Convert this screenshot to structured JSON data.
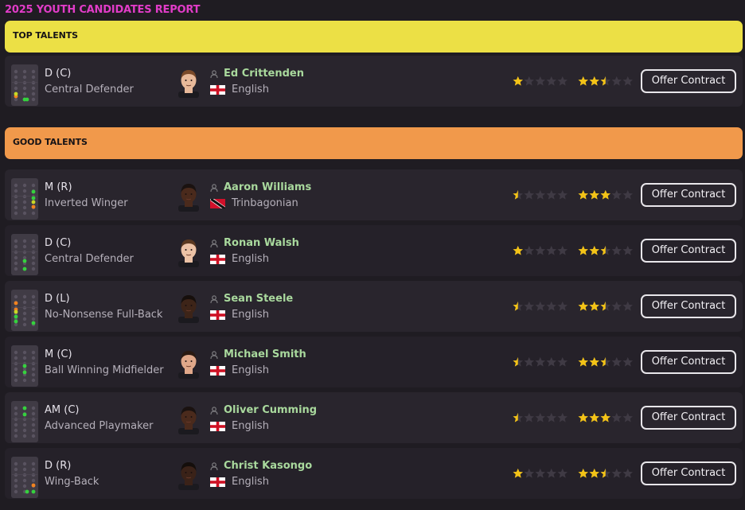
{
  "title": "2025 YOUTH CANDIDATES REPORT",
  "colors": {
    "title": "#e13cc8",
    "top_talents": "#ece045",
    "good_talents": "#f1994b",
    "name": "#a9d99d",
    "star_full": "#f3c317",
    "star_empty": "#3f3a44",
    "dot_green": "#35d23e",
    "dot_orange": "#f28320",
    "dot_yellow": "#c8d826"
  },
  "sections": [
    {
      "label": "TOP TALENTS",
      "color": "#ece045",
      "players": [
        {
          "position": "D (C)",
          "role": "Central Defender",
          "name": "Ed Crittenden",
          "nationality": "English",
          "flag": "england",
          "current_ability_stars": 1.0,
          "potential_ability_stars": 2.5,
          "skin": "#e8b99a",
          "hair": "#7a4a2a",
          "dots": [
            [
              "dl",
              "orange"
            ],
            [
              "dl2",
              "yellow"
            ],
            [
              "dc",
              "green"
            ],
            [
              "dcr",
              "green"
            ]
          ],
          "action": "Offer Contract"
        }
      ]
    },
    {
      "label": "GOOD TALENTS",
      "color": "#f1994b",
      "players": [
        {
          "position": "M (R)",
          "role": "Inverted Winger",
          "name": "Aaron Williams",
          "nationality": "Trinbagonian",
          "flag": "trinidad",
          "current_ability_stars": 0.5,
          "potential_ability_stars": 3.0,
          "skin": "#4a2a1c",
          "hair": "#1a1210",
          "dots": [
            [
              "amr",
              "green"
            ],
            [
              "mr",
              "green"
            ],
            [
              "mr2",
              "yellow"
            ],
            [
              "wbr",
              "orange"
            ]
          ],
          "action": "Offer Contract"
        },
        {
          "position": "D (C)",
          "role": "Central Defender",
          "name": "Ronan Walsh",
          "nationality": "English",
          "flag": "england",
          "current_ability_stars": 1.0,
          "potential_ability_stars": 2.5,
          "skin": "#ecc2a6",
          "hair": "#5a3820",
          "dots": [
            [
              "dm",
              "green"
            ],
            [
              "dc",
              "green"
            ]
          ],
          "action": "Offer Contract"
        },
        {
          "position": "D (L)",
          "role": "No-Nonsense Full-Back",
          "name": "Sean Steele",
          "nationality": "English",
          "flag": "england",
          "current_ability_stars": 0.5,
          "potential_ability_stars": 2.5,
          "skin": "#3d2418",
          "hair": "#160f0c",
          "dots": [
            [
              "aml",
              "orange"
            ],
            [
              "ml",
              "orange"
            ],
            [
              "ml2",
              "yellow"
            ],
            [
              "wbl",
              "green"
            ],
            [
              "dl",
              "green"
            ],
            [
              "dc2",
              "green"
            ]
          ],
          "action": "Offer Contract"
        },
        {
          "position": "M (C)",
          "role": "Ball Winning Midfielder",
          "name": "Michael Smith",
          "nationality": "English",
          "flag": "england",
          "current_ability_stars": 0.5,
          "potential_ability_stars": 2.5,
          "skin": "#e0a88a",
          "hair": "#2a1a12",
          "dots": [
            [
              "mc",
              "green"
            ],
            [
              "dm",
              "green"
            ]
          ],
          "action": "Offer Contract"
        },
        {
          "position": "AM (C)",
          "role": "Advanced Playmaker",
          "name": "Oliver Cumming",
          "nationality": "English",
          "flag": "england",
          "current_ability_stars": 0.5,
          "potential_ability_stars": 3.0,
          "skin": "#4a2a1c",
          "hair": "#1a1210",
          "dots": [
            [
              "st",
              "green"
            ],
            [
              "amc",
              "green"
            ]
          ],
          "action": "Offer Contract"
        },
        {
          "position": "D (R)",
          "role": "Wing-Back",
          "name": "Christ Kasongo",
          "nationality": "English",
          "flag": "england",
          "current_ability_stars": 1.0,
          "potential_ability_stars": 2.5,
          "skin": "#3a2218",
          "hair": "#140e0b",
          "dots": [
            [
              "wbr",
              "orange"
            ],
            [
              "dr",
              "green"
            ],
            [
              "dcr",
              "green"
            ]
          ],
          "action": "Offer Contract"
        }
      ]
    }
  ]
}
